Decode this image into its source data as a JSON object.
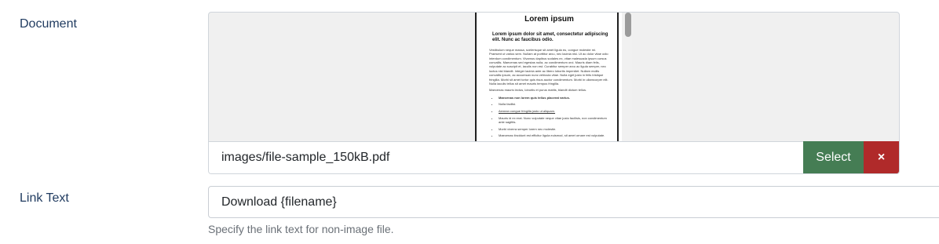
{
  "document_field": {
    "label": "Document",
    "path_value": "images/file-sample_150kB.pdf",
    "select_label": "Select",
    "clear_icon": "×",
    "preview": {
      "title": "Lorem ipsum",
      "subtitle": "Lorem ipsum dolor sit amet, consectetur adipiscing elit. Nunc ac faucibus odio.",
      "paragraph1": "Vestibulum neque massa, scelerisque sit amet ligula eu, congue molestie mi. Praesent ut varius sem. Nullam at porttitor arcu, nec lacinia nisi. Ut ac dolor vitae odio interdum condimentum. Vivamus dapibus sodales ex, vitae malesuada ipsum cursus convallis. Maecenas sed egestas nulla, ac condimentum orci. Mauris diam felis, vulputate ac suscipit et, iaculis non est. Curabitur semper arcu ac ligula semper, nec luctus nisl blandit. Integer lacinia ante ac libero lobortis imperdiet. Nullam mollis convallis ipsum, ac accumsan nunc vehicula vitae. Nulla eget justo in felis tristique fringilla. Morbi sit amet tortor quis risus auctor condimentum. Morbi in ullamcorper elit. Nulla iaculis tellus sit amet mauris tempus fringilla.",
      "paragraph2": "Maecenas mauris lectus, lobortis et purus mattis, blandit dictum tellus.",
      "list": [
        "Maecenas non lorem quis tellus placerat varius.",
        "Nulla facilisi.",
        "Aenean congue fringilla justo ut aliquam.",
        "Mauris id ex erat. Nunc vulputate neque vitae justo facilisis, non condimentum ante sagittis.",
        "Morbi viverra semper lorem nec molestie.",
        "Maecenas tincidunt est efficitur ligula euismod, sit amet ornare est vulputate."
      ]
    }
  },
  "link_text_field": {
    "label": "Link Text",
    "value": "Download {filename}",
    "help": "Specify the link text for non-image file."
  },
  "colors": {
    "select_button": "#457d54",
    "clear_button": "#b02a2a",
    "label": "#1f3a5f"
  }
}
